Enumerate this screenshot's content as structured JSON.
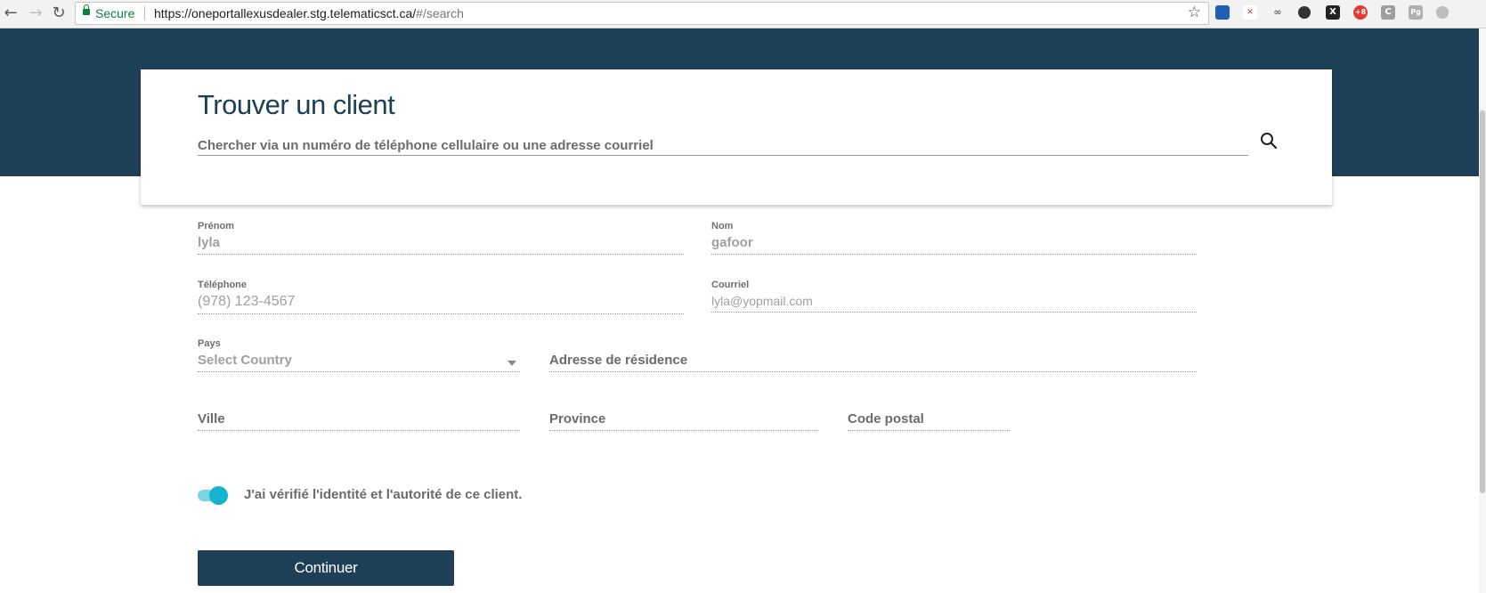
{
  "browser": {
    "secure_label": "Secure",
    "url_host": "https://oneportallexusdealer.stg.telematicsct.ca/",
    "url_path": "#/search",
    "extensions": [
      {
        "icon": "extension-blue-icon",
        "color": "#1f5fb4"
      },
      {
        "icon": "extension-red-sketch-icon",
        "color": "#e0e0e0"
      },
      {
        "icon": "extension-gray-glasses-icon",
        "color": "#d8d8d8"
      },
      {
        "icon": "extension-dark-circle-icon",
        "color": "#333333"
      },
      {
        "icon": "extension-x-icon",
        "color": "#222222"
      },
      {
        "icon": "extension-red-badge-icon",
        "color": "#e53935"
      },
      {
        "icon": "extension-c-icon",
        "color": "#9e9e9e"
      },
      {
        "icon": "extension-pg-icon",
        "color": "#b0b0b0"
      },
      {
        "icon": "extension-circle-icon",
        "color": "#bdbdbd"
      }
    ]
  },
  "colors": {
    "brand_navy": "#1e4056",
    "toggle_accent": "#13b3d2"
  },
  "search": {
    "title": "Trouver un client",
    "placeholder": "Chercher via un numéro de téléphone cellulaire ou une adresse courriel"
  },
  "form": {
    "first_name": {
      "label": "Prénom",
      "value": "lyla"
    },
    "last_name": {
      "label": "Nom",
      "value": "gafoor"
    },
    "phone": {
      "label": "Téléphone",
      "placeholder": "(978) 123-4567"
    },
    "email": {
      "label": "Courriel",
      "placeholder": "lyla@yopmail.com"
    },
    "country": {
      "label": "Pays",
      "selected": "Select Country"
    },
    "address": {
      "placeholder": "Adresse de résidence"
    },
    "city": {
      "placeholder": "Ville"
    },
    "province": {
      "placeholder": "Province"
    },
    "postal_code": {
      "placeholder": "Code postal"
    }
  },
  "verification": {
    "label": "J'ai vérifié l'identité et l'autorité de ce client.",
    "checked": true
  },
  "actions": {
    "continue_label": "Continuer"
  }
}
